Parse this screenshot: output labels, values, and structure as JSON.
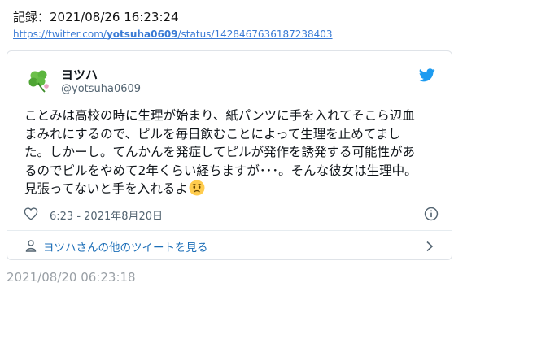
{
  "record": {
    "text": "記録：2021/08/26 16:23:24"
  },
  "source_url": {
    "prefix": "https://twitter.com/",
    "handle": "yotsuha0609",
    "suffix": "/status/1428467636187238403"
  },
  "tweet": {
    "display_name": "ヨツハ",
    "handle": "@yotsuha0609",
    "text": "ことみは高校の時に生理が始まり、紙パンツに手を入れてそこら辺血\nまみれにするので、ピルを毎日飲むことによって生理を止めてまし\nた。しかーし。てんかんを発症してピルが発作を誘発する可能性があ\nるのでピルをやめて2年くらい経ちますが･･･。そんな彼女は生理中。\n見張ってないと手を入れるよ",
    "emoji": "worried-face-emoji",
    "timestamp": "6:23 - 2021年8月20日",
    "more_tweets_label": "ヨツハさんの他のツイートを見る"
  },
  "footer": {
    "date": "2021/08/20 06:23:18"
  },
  "colors": {
    "link": "#3a7bd5",
    "twitter_blue": "#1d9bf0",
    "clover_green": "#5bb53d"
  },
  "icons": [
    "clover-avatar",
    "twitter-bird-icon",
    "heart-icon",
    "info-icon",
    "person-icon",
    "chevron-right-icon"
  ]
}
